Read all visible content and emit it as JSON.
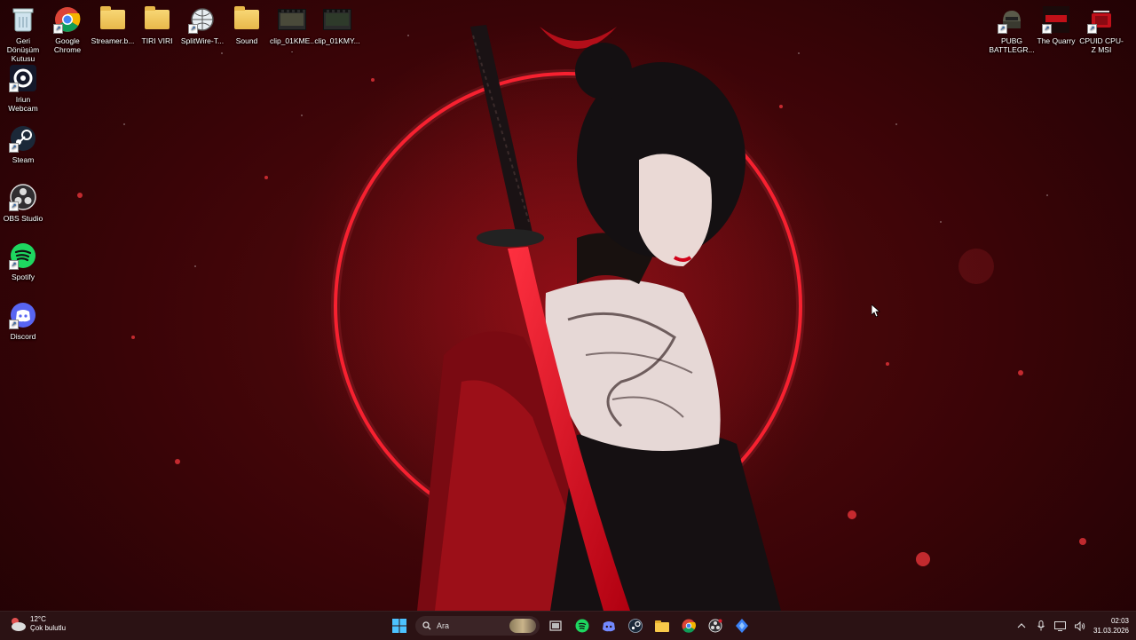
{
  "desktop": {
    "left_column": [
      {
        "label": "Geri Dönüşüm Kutusu",
        "icon": "recycle-bin-icon"
      },
      {
        "label": "Iriun Webcam",
        "icon": "webcam-icon"
      },
      {
        "label": "Steam",
        "icon": "steam-icon"
      },
      {
        "label": "OBS Studio",
        "icon": "obs-icon"
      },
      {
        "label": "Spotify",
        "icon": "spotify-icon"
      },
      {
        "label": "Discord",
        "icon": "discord-icon"
      }
    ],
    "top_row": [
      {
        "label": "Google Chrome",
        "icon": "chrome-icon"
      },
      {
        "label": "Streamer.b...",
        "icon": "folder-icon"
      },
      {
        "label": "TIRI VIRI",
        "icon": "folder-icon"
      },
      {
        "label": "SplitWire-T...",
        "icon": "splitwire-icon"
      },
      {
        "label": "Sound",
        "icon": "folder-icon"
      },
      {
        "label": "clip_01KME...",
        "icon": "video-file-icon"
      },
      {
        "label": "clip_01KMY...",
        "icon": "video-file-icon"
      }
    ],
    "top_right": [
      {
        "label": "PUBG BATTLEGR...",
        "icon": "pubg-icon"
      },
      {
        "label": "The Quarry",
        "icon": "the-quarry-icon"
      },
      {
        "label": "CPUID CPU-Z MSI",
        "icon": "cpuz-icon"
      }
    ]
  },
  "taskbar": {
    "weather": {
      "temp": "12°C",
      "condition": "Çok bulutlu"
    },
    "search_placeholder": "Ara",
    "pinned": [
      "start-icon",
      "search",
      "task-view-icon",
      "spotify-icon",
      "discord-icon",
      "steam-icon",
      "file-explorer-icon",
      "chrome-icon",
      "obs-icon",
      "app-icon"
    ],
    "clock": {
      "time": "02:03",
      "date": "31.03.2026"
    }
  },
  "colors": {
    "accent_red": "#e0101e",
    "taskbar_bg": "#2b1214"
  }
}
